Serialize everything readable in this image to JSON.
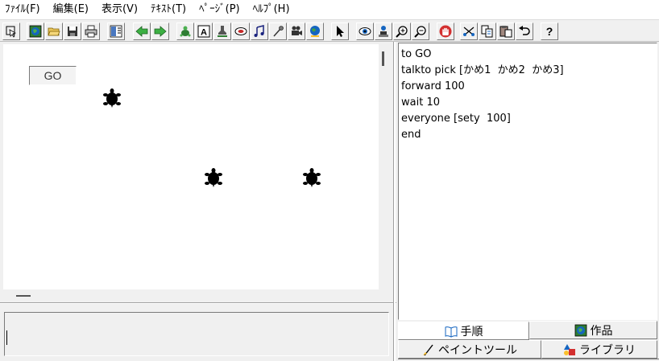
{
  "menubar": {
    "items": [
      "ﾌｧｲﾙ(F)",
      "編集(E)",
      "表示(V)",
      "ﾃｷｽﾄ(T)",
      "ﾍﾟｰｼﾞ(P)",
      "ﾍﾙﾌﾟ(H)"
    ]
  },
  "toolbar": {
    "buttons": [
      "select-tool",
      "globe",
      "open",
      "save",
      "print",
      "layout",
      "back",
      "forward",
      "turtle",
      "text-box",
      "stamp",
      "shape",
      "music",
      "paint-brush",
      "video",
      "earth",
      "pointer",
      "eye",
      "snapshot",
      "zoom-in",
      "zoom-out",
      "stop",
      "cut",
      "copy",
      "paste",
      "undo",
      "help"
    ]
  },
  "canvas": {
    "go_button_label": "GO",
    "turtle_count": 3
  },
  "editor": {
    "lines": [
      "to GO",
      "talkto pick [かめ1  かめ2  かめ3]",
      "forward 100",
      "wait 10",
      "everyone [sety  100]",
      "end"
    ]
  },
  "tabs": {
    "procedures": "手順",
    "projects": "作品",
    "paint_tools": "ペイントツール",
    "library": "ライブラリ"
  },
  "command_box": {
    "value": ""
  },
  "colors": {
    "window_bg": "#f0f0f0",
    "canvas_bg": "#ffffff",
    "turtle": "#000000"
  }
}
